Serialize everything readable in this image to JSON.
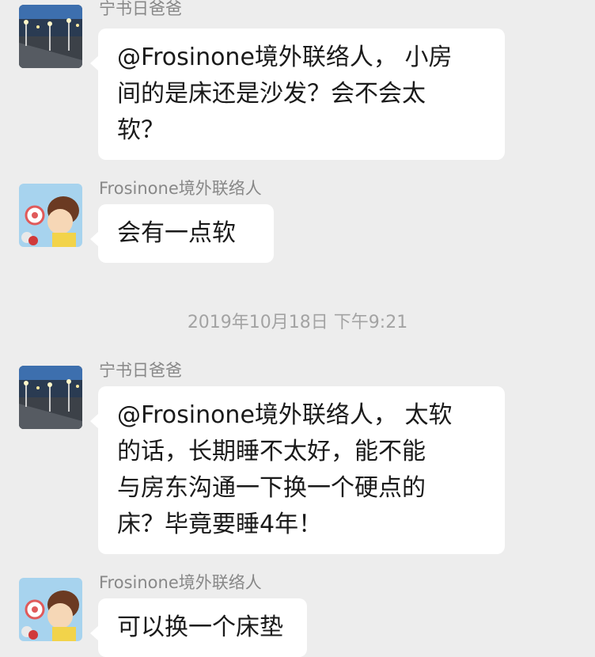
{
  "messages": [
    {
      "sender": "宁书日爸爸",
      "avatar_icon": "night-street-avatar",
      "lines": [
        "@Frosinone境外联络人， 小房",
        "间的是床还是沙发？会不会太",
        "软？"
      ]
    },
    {
      "sender": "Frosinone境外联络人",
      "avatar_icon": "cartoon-boy-avatar",
      "lines": [
        "会有一点软"
      ]
    },
    {
      "sender": "宁书日爸爸",
      "avatar_icon": "night-street-avatar",
      "lines": [
        "@Frosinone境外联络人， 太软",
        "的话，长期睡不太好，能不能",
        "与房东沟通一下换一个硬点的",
        "床？毕竟要睡4年！"
      ]
    },
    {
      "sender": "Frosinone境外联络人",
      "avatar_icon": "cartoon-boy-avatar",
      "lines": [
        "可以换一个床垫"
      ]
    }
  ],
  "timestamp": "2019年10月18日 下午9:21",
  "colors": {
    "background": "#ededed",
    "bubble": "#ffffff",
    "meta_text": "#a3a3a3"
  }
}
